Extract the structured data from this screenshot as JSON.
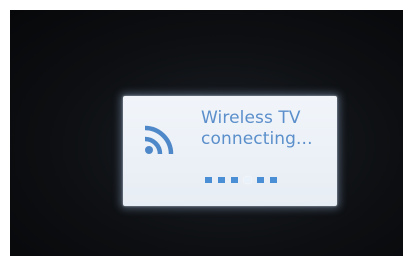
{
  "dialog": {
    "icon": "wifi-icon",
    "title_line1": "Wireless TV",
    "title_line2": "connecting...",
    "progress": {
      "dot_count": 6,
      "active_index": 3
    }
  },
  "colors": {
    "accent": "#5b8fcb",
    "dot": "#4a8fd6",
    "dot_active": "#e9f2fb",
    "dialog_bg": "#eef2f7",
    "screen_bg": "#0d0f12"
  }
}
